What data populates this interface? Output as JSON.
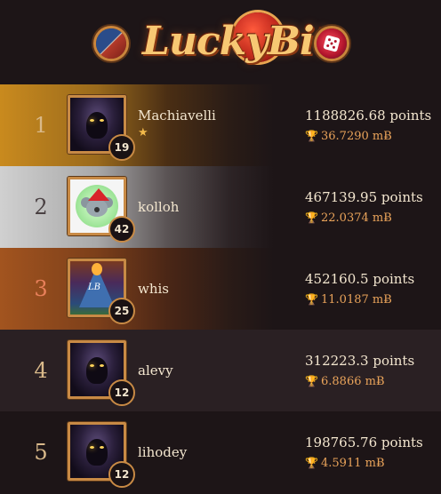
{
  "brand": {
    "logo_text": "LuckyBit"
  },
  "colors": {
    "background": "#1d1517",
    "gold": "#c88a45",
    "accent": "#e9a35a",
    "rank1": "#c98a1e",
    "rank2": "#c9c9c9",
    "rank3": "#a2541f"
  },
  "icons": {
    "left_badge": "bitcoin-dice-coin-icon",
    "right_badge": "red-dice-icon",
    "trophy": "trophy-icon",
    "star": "star-icon"
  },
  "leaderboard": [
    {
      "rank": "1",
      "name": "Machiavelli",
      "level": "19",
      "star": "★",
      "points": "1188826.68 points",
      "btc": "36.7290 mɃ",
      "avatar": "dark-hooded-figure"
    },
    {
      "rank": "2",
      "name": "kolloh",
      "level": "42",
      "star": "",
      "points": "467139.95 points",
      "btc": "22.0374 mɃ",
      "avatar": "koala-santa-hat"
    },
    {
      "rank": "3",
      "name": "whis",
      "level": "25",
      "star": "",
      "points": "452160.5 points",
      "btc": "11.0187 mɃ",
      "avatar": "rocket-lb"
    },
    {
      "rank": "4",
      "name": "alevy",
      "level": "12",
      "star": "",
      "points": "312223.3 points",
      "btc": "6.8866 mɃ",
      "avatar": "dark-hooded-figure"
    },
    {
      "rank": "5",
      "name": "lihodey",
      "level": "12",
      "star": "",
      "points": "198765.76 points",
      "btc": "4.5911 mɃ",
      "avatar": "dark-hooded-figure"
    }
  ]
}
